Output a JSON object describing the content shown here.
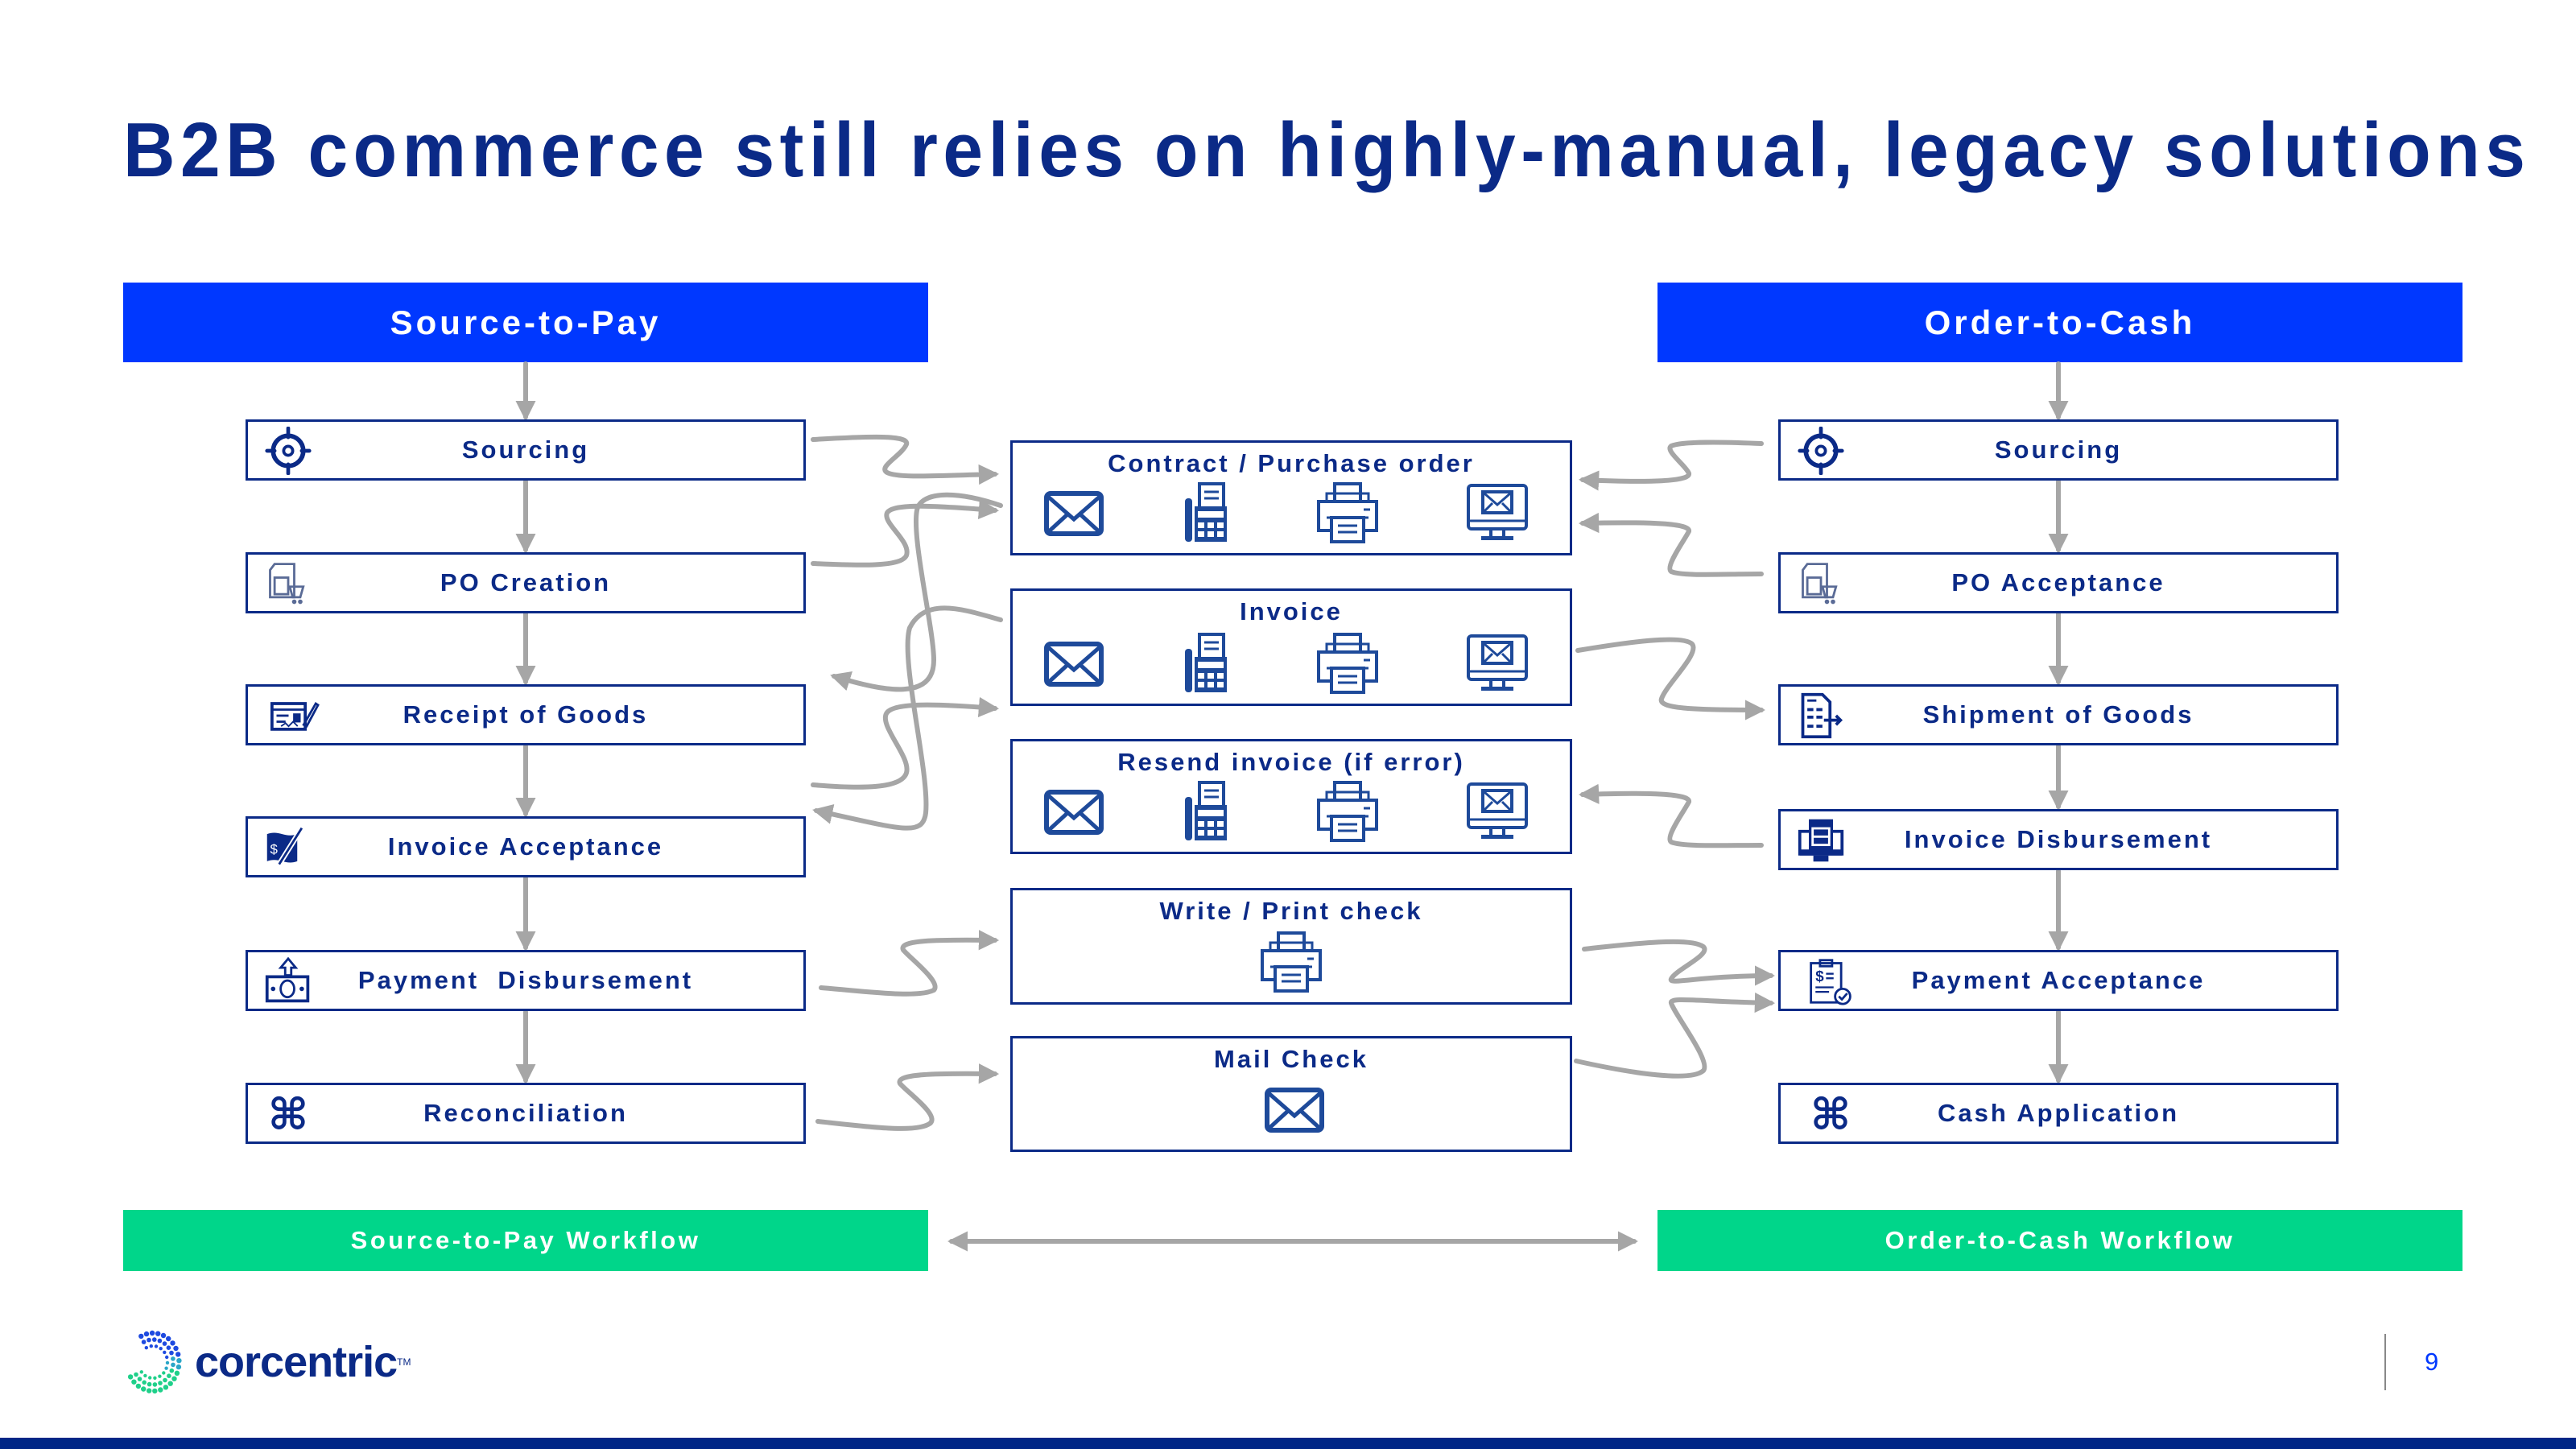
{
  "title": "B2B commerce still relies on highly-manual, legacy solutions",
  "colors": {
    "navy": "#0B2A87",
    "header_blue": "#0038FF",
    "workflow_green": "#00D68A",
    "connector_gray": "#A6A6A6",
    "footer_band": "#002686"
  },
  "source_to_pay": {
    "header": "Source-to-Pay",
    "steps": [
      {
        "label": "Sourcing",
        "icon": "target-icon"
      },
      {
        "label": "PO Creation",
        "icon": "document-cart-icon"
      },
      {
        "label": "Receipt of Goods",
        "icon": "check-signature-icon"
      },
      {
        "label": "Invoice Acceptance",
        "icon": "invoice-pen-icon"
      },
      {
        "label": "Payment  Disbursement",
        "icon": "money-out-icon"
      },
      {
        "label": "Reconciliation",
        "icon": "command-icon"
      }
    ],
    "workflow": "Source-to-Pay Workflow"
  },
  "order_to_cash": {
    "header": "Order-to-Cash",
    "steps": [
      {
        "label": "Sourcing",
        "icon": "target-icon"
      },
      {
        "label": "PO Acceptance",
        "icon": "document-cart-icon"
      },
      {
        "label": "Shipment of Goods",
        "icon": "document-export-icon"
      },
      {
        "label": "Invoice Disbursement",
        "icon": "computer-document-icon"
      },
      {
        "label": "Payment Acceptance",
        "icon": "clipboard-check-icon"
      },
      {
        "label": "Cash Application",
        "icon": "command-icon"
      }
    ],
    "workflow": "Order-to-Cash Workflow"
  },
  "channels": [
    {
      "label": "Contract / Purchase order",
      "icons": [
        "envelope-icon",
        "fax-icon",
        "printer-icon",
        "monitor-mail-icon"
      ]
    },
    {
      "label": "Invoice",
      "icons": [
        "envelope-icon",
        "fax-icon",
        "printer-icon",
        "monitor-mail-icon"
      ]
    },
    {
      "label": "Resend invoice (if error)",
      "icons": [
        "envelope-icon",
        "fax-icon",
        "printer-icon",
        "monitor-mail-icon"
      ]
    },
    {
      "label": "Write / Print check",
      "icons": [
        "printer-icon"
      ]
    },
    {
      "label": "Mail Check",
      "icons": [
        "envelope-icon"
      ]
    }
  ],
  "footer": {
    "logo_text": "corcentric",
    "logo_tm": "TM",
    "page_number": "9"
  }
}
